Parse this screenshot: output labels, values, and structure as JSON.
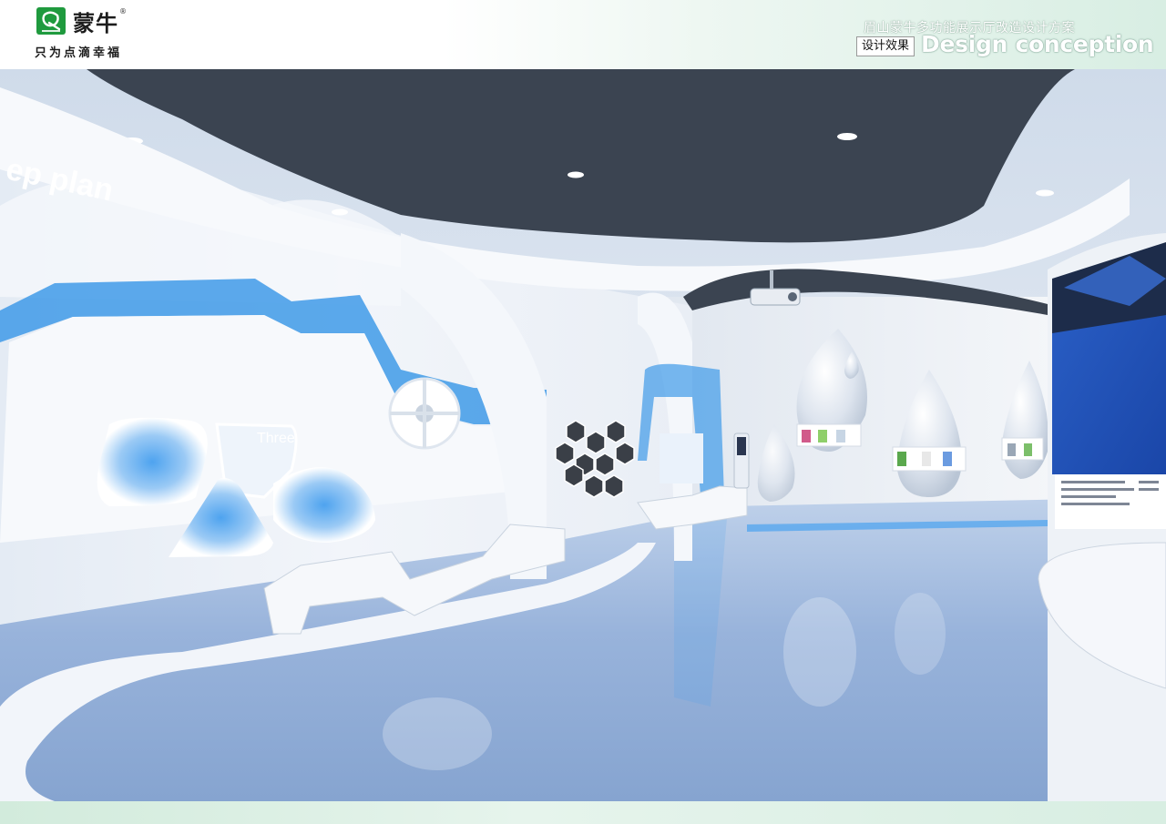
{
  "header": {
    "brand": "蒙牛",
    "reg_mark": "®",
    "slogan": "只为点滴幸福",
    "project_title": "眉山蒙牛多功能展示厅改造设计方案",
    "tag": "设计效果",
    "headline": "Design conception"
  },
  "scene": {
    "wall_text_plan": "ep plan",
    "panel_text": "Three",
    "colors": {
      "accent_blue": "#3f9ae8",
      "ceiling_dark": "#3c4552",
      "floor_blue": "#8fb0d8"
    }
  }
}
